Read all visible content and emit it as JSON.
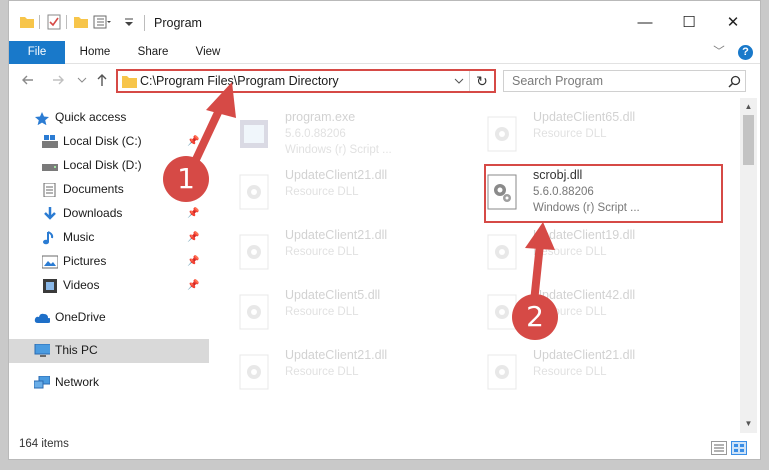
{
  "window": {
    "title": "Program",
    "controls": {
      "minimize": "—",
      "maximize": "☐",
      "close": "✕"
    }
  },
  "ribbon": {
    "tabs": [
      "File",
      "Home",
      "Share",
      "View"
    ],
    "expand": "﹀",
    "help": "?"
  },
  "address": {
    "path": "C:\\Program Files\\Program Directory",
    "dropdown": "⌄",
    "refresh": "↻"
  },
  "search": {
    "placeholder": "Search Program"
  },
  "nav": {
    "quick_access": "Quick access",
    "items": [
      {
        "label": "Local Disk (C:)",
        "pinned": true
      },
      {
        "label": "Local Disk (D:)",
        "pinned": true
      },
      {
        "label": "Documents",
        "pinned": true
      },
      {
        "label": "Downloads",
        "pinned": true
      },
      {
        "label": "Music",
        "pinned": true
      },
      {
        "label": "Pictures",
        "pinned": true
      },
      {
        "label": "Videos",
        "pinned": true
      }
    ],
    "onedrive": "OneDrive",
    "this_pc": "This PC",
    "network": "Network"
  },
  "files": [
    {
      "name": "program.exe",
      "line1": "5.6.0.88206",
      "line2": "Windows (r) Script ..."
    },
    {
      "name": "UpdateClient65.dll",
      "line1": "Resource DLL",
      "line2": ""
    },
    {
      "name": "UpdateClient21.dll",
      "line1": "Resource DLL",
      "line2": ""
    },
    {
      "name": "scrobj.dll",
      "line1": "5.6.0.88206",
      "line2": "Windows (r) Script ..."
    },
    {
      "name": "UpdateClient21.dll",
      "line1": "Resource DLL",
      "line2": ""
    },
    {
      "name": "UpdateClient19.dll",
      "line1": "Resource DLL",
      "line2": ""
    },
    {
      "name": "UpdateClient5.dll",
      "line1": "Resource DLL",
      "line2": ""
    },
    {
      "name": "UpdateClient42.dll",
      "line1": "Resource DLL",
      "line2": ""
    },
    {
      "name": "UpdateClient21.dll",
      "line1": "Resource DLL",
      "line2": ""
    },
    {
      "name": "UpdateClient21.dll",
      "line1": "Resource DLL",
      "line2": ""
    }
  ],
  "status": {
    "items": "164 items"
  },
  "callouts": {
    "one": "1",
    "two": "2"
  },
  "colors": {
    "accent": "#1979ca",
    "highlight": "#d64a46",
    "folder": "#f7c54a"
  }
}
